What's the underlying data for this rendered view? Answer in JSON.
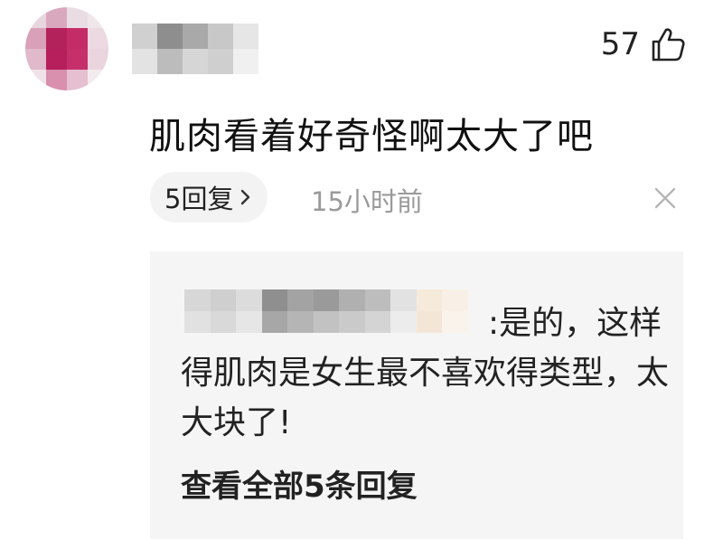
{
  "comment": {
    "author_name": "",
    "likes": "57",
    "text": "肌肉看着好奇怪啊太大了吧",
    "reply_count_label": "5回复",
    "timestamp": "15小时前"
  },
  "reply": {
    "author_name": "",
    "text": ":是的，这样得肌肉是女生最不喜欢得类型，太大块了!",
    "view_all_label": "查看全部5条回复"
  },
  "icons": {
    "like": "thumb-up-icon",
    "reply_chevron": "chevron-right-icon",
    "dismiss": "close-icon"
  },
  "colors": {
    "text": "#1a1a1a",
    "secondary_text": "#9a9a9a",
    "pill_background": "#f3f3f3",
    "reply_background": "#f5f5f5",
    "avatar_accent": "#c2185b"
  }
}
